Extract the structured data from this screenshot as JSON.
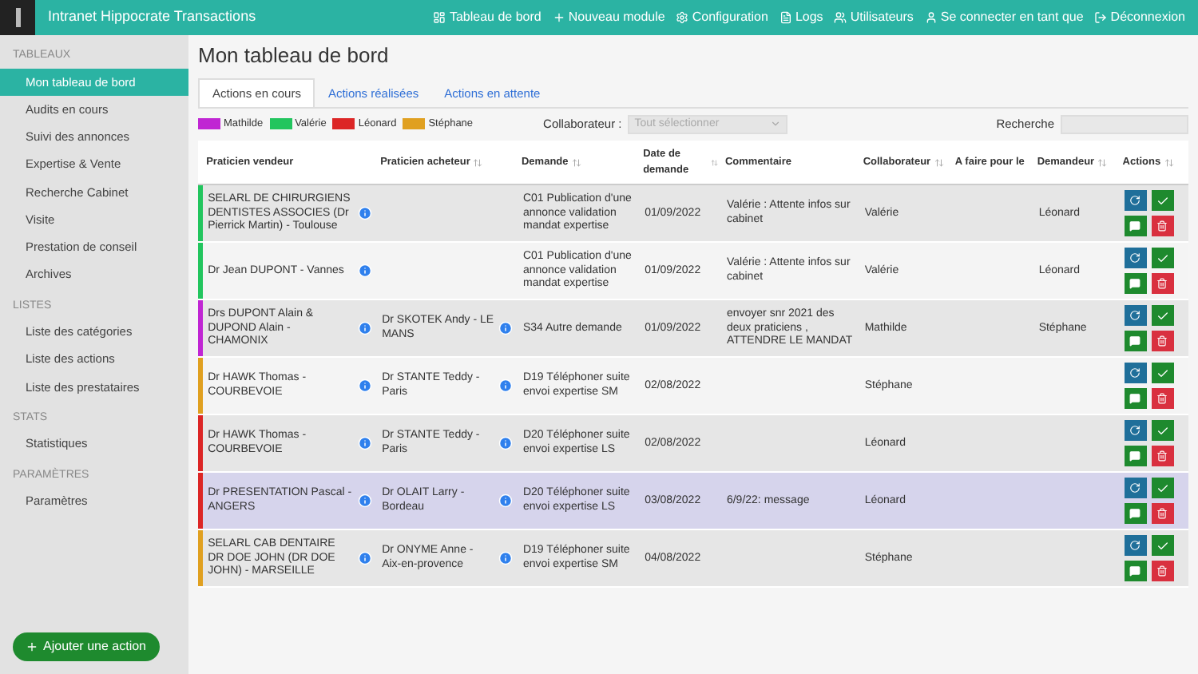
{
  "topbar": {
    "title": "Intranet Hippocrate Transactions",
    "nav": [
      {
        "kind": "dashboard",
        "label": "Tableau de bord"
      },
      {
        "kind": "plus",
        "label": "Nouveau module"
      },
      {
        "kind": "settings",
        "label": "Configuration"
      },
      {
        "kind": "file",
        "label": "Logs"
      },
      {
        "kind": "users",
        "label": "Utilisateurs"
      },
      {
        "kind": "user",
        "label": "Se connecter en tant que"
      },
      {
        "kind": "logout",
        "label": "Déconnexion"
      }
    ]
  },
  "sidebar": {
    "sections": [
      {
        "title": "TABLEAUX",
        "items": [
          {
            "label": "Mon tableau de bord",
            "selected": true
          },
          {
            "label": "Audits en cours",
            "selected": false
          },
          {
            "label": "Suivi des annonces",
            "selected": false
          },
          {
            "label": "Expertise & Vente",
            "selected": false
          },
          {
            "label": "Recherche Cabinet",
            "selected": false
          },
          {
            "label": "Visite",
            "selected": false
          },
          {
            "label": "Prestation de conseil",
            "selected": false
          },
          {
            "label": "Archives",
            "selected": false
          }
        ]
      },
      {
        "title": "LISTES",
        "items": [
          {
            "label": "Liste des catégories",
            "selected": false
          },
          {
            "label": "Liste des actions",
            "selected": false
          },
          {
            "label": "Liste des prestataires",
            "selected": false
          }
        ]
      },
      {
        "title": "STATS",
        "items": [
          {
            "label": "Statistiques",
            "selected": false
          }
        ]
      },
      {
        "title": "PARAMÈTRES",
        "items": [
          {
            "label": "Paramètres",
            "selected": false
          }
        ]
      }
    ],
    "add_button": "Ajouter une action"
  },
  "page_title": "Mon tableau de bord",
  "tabs": [
    {
      "label": "Actions en cours",
      "selected": true
    },
    {
      "label": "Actions réalisées",
      "selected": false
    },
    {
      "label": "Actions en attente",
      "selected": false
    }
  ],
  "legend": [
    {
      "name": "Mathilde",
      "color": "#c026d3"
    },
    {
      "name": "Valérie",
      "color": "#22c55e"
    },
    {
      "name": "Léonard",
      "color": "#dc2626"
    },
    {
      "name": "Stéphane",
      "color": "#e0a020"
    }
  ],
  "filter": {
    "label": "Collaborateur :",
    "value": "Tout sélectionner",
    "search_label": "Recherche"
  },
  "table": {
    "columns": [
      {
        "label": "Praticien vendeur",
        "sortable": false
      },
      {
        "label": "Praticien acheteur",
        "sortable": true
      },
      {
        "label": "Demande",
        "sortable": true
      },
      {
        "label": "Date de demande",
        "sortable": true
      },
      {
        "label": "Commentaire",
        "sortable": false
      },
      {
        "label": "Collaborateur",
        "sortable": true
      },
      {
        "label": "A faire pour le",
        "sortable": false
      },
      {
        "label": "Demandeur",
        "sortable": true
      },
      {
        "label": "Actions",
        "sortable": true
      }
    ],
    "rows": [
      {
        "color": "#22c55e",
        "selected": false,
        "seller": "SELARL DE CHIRURGIENS DENTISTES ASSOCIES (Dr Pierrick Martin) - Toulouse",
        "request": "C01 Publication d'une annonce validation mandat expertise",
        "date": "01/09/2022",
        "comment": "Valérie : Attente infos sur cabinet",
        "collaborator": "Valérie",
        "requester": "Léonard"
      },
      {
        "color": "#22c55e",
        "selected": false,
        "seller": "Dr Jean DUPONT - Vannes",
        "request": "C01 Publication d'une annonce validation mandat expertise",
        "date": "01/09/2022",
        "comment": "Valérie : Attente infos sur cabinet",
        "collaborator": "Valérie",
        "requester": "Léonard"
      },
      {
        "color": "#c026d3",
        "selected": false,
        "seller": "Drs DUPONT Alain & DUPOND Alain - CHAMONIX",
        "buyer": "Dr SKOTEK Andy - LE MANS",
        "request": "S34 Autre demande",
        "date": "01/09/2022",
        "comment": "envoyer snr 2021 des deux praticiens , ATTENDRE LE MANDAT",
        "collaborator": "Mathilde",
        "requester": "Stéphane"
      },
      {
        "color": "#e0a020",
        "selected": false,
        "seller": "Dr HAWK Thomas - COURBEVOIE",
        "buyer": "Dr STANTE Teddy - Paris",
        "request": "D19 Téléphoner suite envoi expertise SM",
        "date": "02/08/2022",
        "collaborator": "Stéphane"
      },
      {
        "color": "#dc2626",
        "selected": false,
        "seller": "Dr HAWK Thomas - COURBEVOIE",
        "buyer": "Dr STANTE Teddy - Paris",
        "request": "D20 Téléphoner suite envoi expertise LS",
        "date": "02/08/2022",
        "collaborator": "Léonard"
      },
      {
        "color": "#dc2626",
        "selected": true,
        "seller": "Dr PRESENTATION Pascal - ANGERS",
        "buyer": "Dr OLAIT Larry - Bordeau",
        "request": "D20 Téléphoner suite envoi expertise LS",
        "date": "03/08/2022",
        "comment": "6/9/22: message",
        "collaborator": "Léonard"
      },
      {
        "color": "#e0a020",
        "selected": false,
        "seller": "SELARL CAB DENTAIRE DR DOE JOHN (DR DOE JOHN) - MARSEILLE",
        "buyer": "Dr ONYME Anne - Aix-en-provence",
        "request": "D19 Téléphoner suite envoi expertise SM",
        "date": "04/08/2022",
        "collaborator": "Stéphane"
      }
    ]
  }
}
